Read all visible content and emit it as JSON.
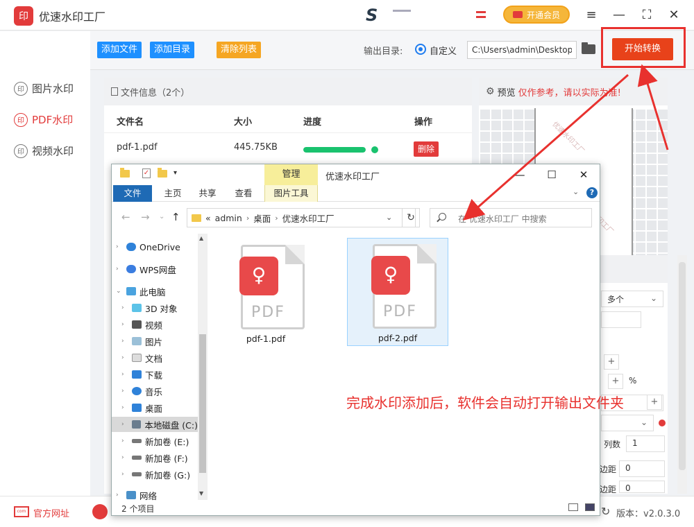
{
  "app": {
    "title": "优速水印工厂",
    "logo_glyph": "印"
  },
  "header": {
    "vip_label": "开通会员"
  },
  "sidebar": {
    "items": [
      {
        "label": "图片水印",
        "glyph": "印",
        "active": false
      },
      {
        "label": "PDF水印",
        "glyph": "印",
        "active": true
      },
      {
        "label": "视频水印",
        "glyph": "印",
        "active": false
      }
    ]
  },
  "toolbar": {
    "add_file": "添加文件",
    "add_dir": "添加目录",
    "clear_list": "清除列表",
    "output_label": "输出目录:",
    "radio_custom": "自定义",
    "output_path": "C:\\Users\\admin\\Desktop",
    "start": "开始转换"
  },
  "file_panel": {
    "title": "文件信息（2个）",
    "columns": {
      "name": "文件名",
      "size": "大小",
      "progress": "进度",
      "action": "操作"
    },
    "rows": [
      {
        "name": "pdf-1.pdf",
        "size": "445.75KB",
        "progress": 1.0,
        "action": "删除"
      }
    ]
  },
  "preview": {
    "title": "预览",
    "warning": "仅作参考，请以实际为准!",
    "watermark": "优速水印工厂"
  },
  "settings": {
    "mode_select": "多个",
    "percent_unit": "%",
    "cols_label": "列数",
    "cols_value": "1",
    "margin_label": "边距",
    "margin_value_1": "0",
    "margin_value_2": "0"
  },
  "bottom": {
    "site_icon": "com",
    "site_link": "官方网址",
    "version": "版本：v2.0.3.0"
  },
  "explorer": {
    "manage_tab": "管理",
    "title": "优速水印工厂",
    "ribbon_tabs": [
      "文件",
      "主页",
      "共享",
      "查看",
      "图片工具"
    ],
    "address": [
      "«",
      "admin",
      "桌面",
      "优速水印工厂"
    ],
    "search_placeholder": "在 优速水印工厂 中搜索",
    "tree": [
      "OneDrive",
      "WPS网盘",
      "此电脑",
      "3D 对象",
      "视频",
      "图片",
      "文档",
      "下载",
      "音乐",
      "桌面",
      "本地磁盘 (C:)",
      "新加卷 (E:)",
      "新加卷 (F:)",
      "新加卷 (G:)",
      "网络"
    ],
    "files": [
      {
        "name": "pdf-1.pdf",
        "type_label": "PDF",
        "selected": false
      },
      {
        "name": "pdf-2.pdf",
        "type_label": "PDF",
        "selected": true
      }
    ],
    "status": "2 个项目"
  },
  "annotation": {
    "text": "完成水印添加后，软件会自动打开输出文件夹"
  },
  "colors": {
    "accent_red": "#e8312e",
    "primary_blue": "#1e90ff",
    "orange": "#f5a623",
    "progress_green": "#19c26e"
  }
}
